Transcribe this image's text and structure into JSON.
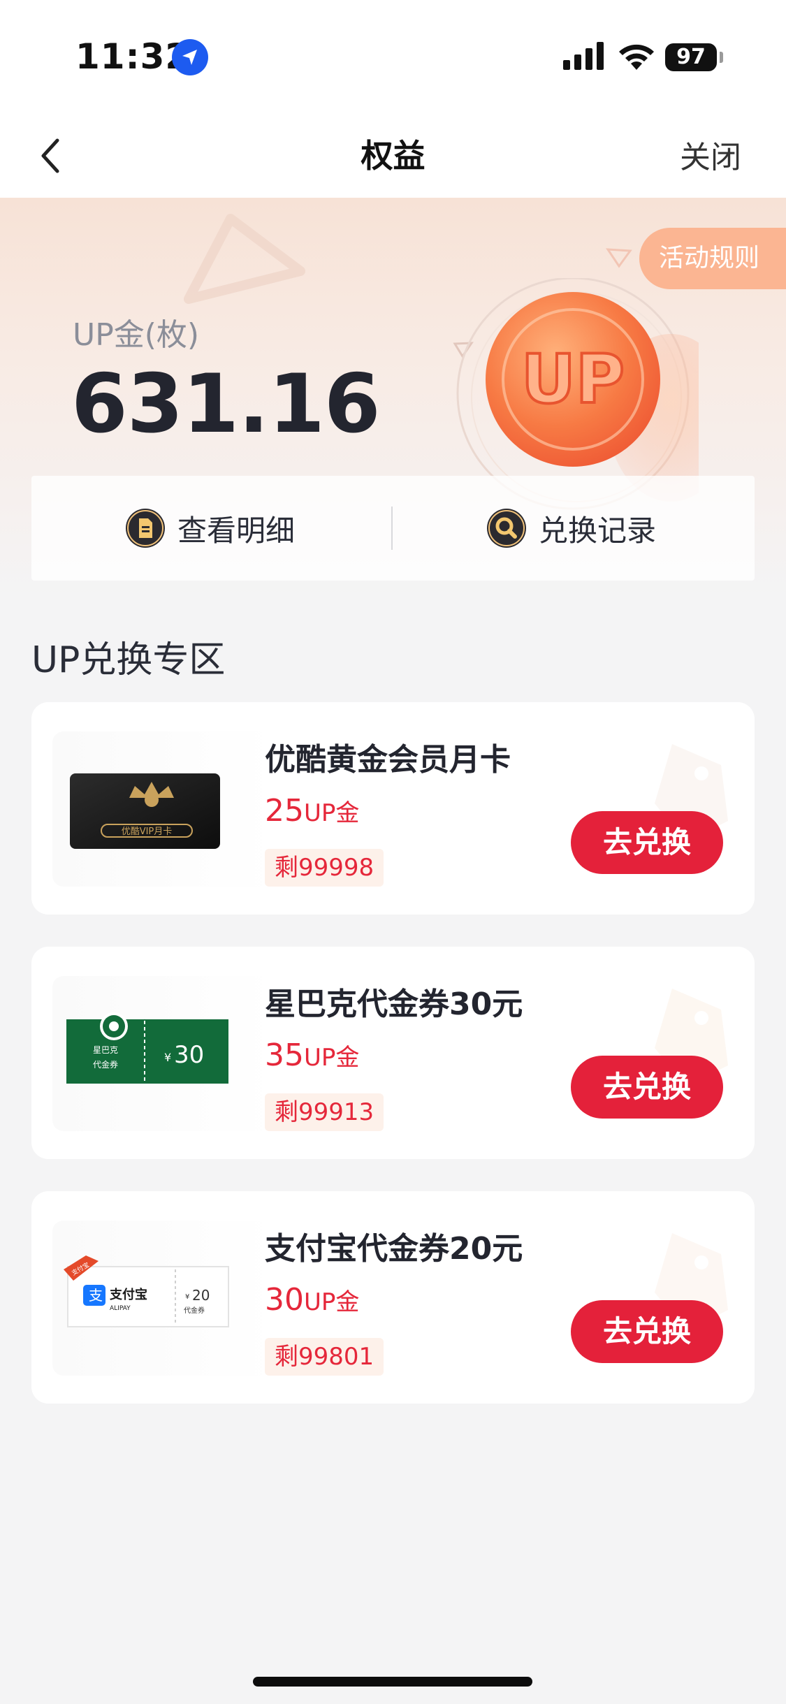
{
  "status_bar": {
    "time": "11:32",
    "battery": "97",
    "icons": [
      "location-icon",
      "signal-icon",
      "wifi-icon",
      "battery-icon"
    ]
  },
  "nav": {
    "title": "权益",
    "close_label": "关闭",
    "back_icon": "chevron-left-icon"
  },
  "hero": {
    "rules_label": "活动规则",
    "balance_label": "UP金(枚)",
    "balance_value": "631.16",
    "coin_text": "UP",
    "actions": [
      {
        "label": "查看明细",
        "icon": "document-icon"
      },
      {
        "label": "兑换记录",
        "icon": "search-icon"
      }
    ]
  },
  "section": {
    "title": "UP兑换专区"
  },
  "products": [
    {
      "name": "优酷黄金会员月卡",
      "price": "25",
      "unit": "UP金",
      "stock": "剩99998",
      "button": "去兑换",
      "thumb_text": "优酷VIP月卡"
    },
    {
      "name": "星巴克代金券30元",
      "price": "35",
      "unit": "UP金",
      "stock": "剩99913",
      "button": "去兑换",
      "thumb_text_1": "星巴克",
      "thumb_text_2": "代金券",
      "thumb_amount": "30",
      "thumb_currency": "¥"
    },
    {
      "name": "支付宝代金券20元",
      "price": "30",
      "unit": "UP金",
      "stock": "剩99801",
      "button": "去兑换",
      "thumb_ribbon": "支付宝",
      "thumb_brand": "支付宝",
      "thumb_brand_en": "ALIPAY",
      "thumb_amount": "20",
      "thumb_currency": "¥",
      "thumb_caption": "代金券"
    }
  ],
  "colors": {
    "accent_red": "#e4213a",
    "price_red": "#e5273a",
    "rules_orange": "#fbb592",
    "coin_orange": "#f4703f"
  }
}
